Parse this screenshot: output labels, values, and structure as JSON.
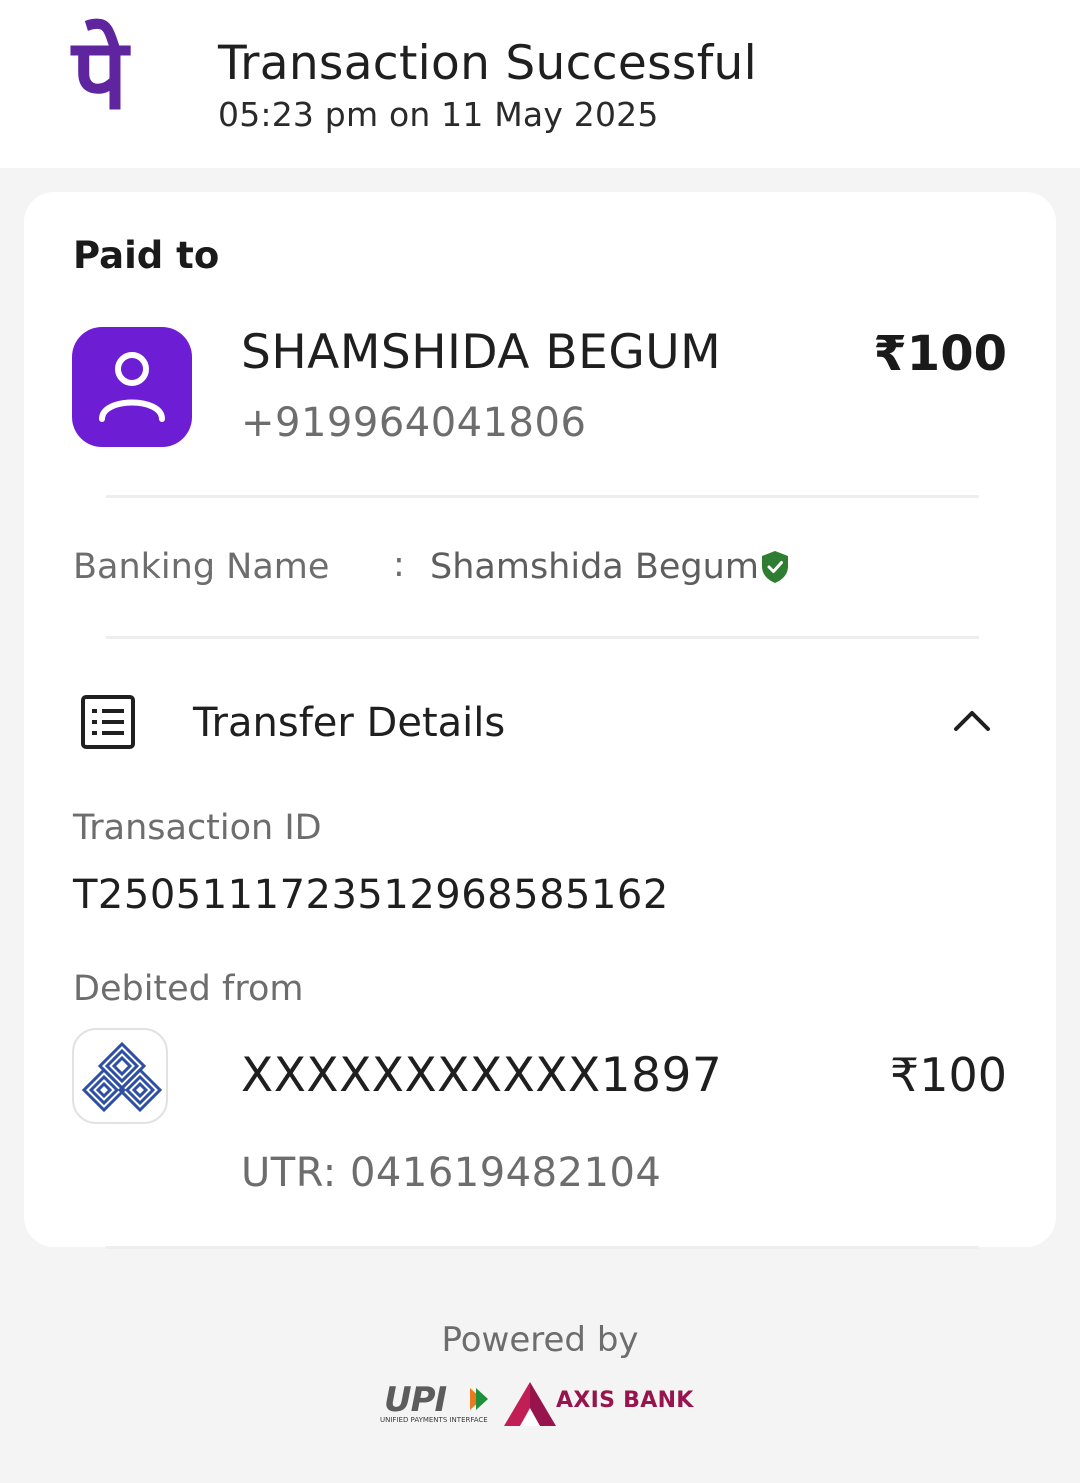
{
  "header": {
    "logo_glyph": "पे",
    "title": "Transaction Successful",
    "timestamp": "05:23 pm on 11 May 2025"
  },
  "paid_to": {
    "section_label": "Paid to",
    "name": "SHAMSHIDA BEGUM",
    "phone": "+919964041806",
    "amount": "₹100",
    "avatar_icon": "person-icon",
    "avatar_color": "#6d1ed4"
  },
  "banking_name": {
    "label": "Banking Name",
    "separator": ":",
    "value": "Shamshida Begum",
    "verified_icon": "verified-shield-icon",
    "verified_color": "#2e7d32"
  },
  "transfer_details": {
    "title": "Transfer Details",
    "icon": "list-icon",
    "toggle_icon": "chevron-up-icon",
    "transaction_id_label": "Transaction ID",
    "transaction_id": "T2505111723512968585162",
    "debited_from_label": "Debited from",
    "account_number": "XXXXXXXXXXX1897",
    "amount": "₹100",
    "utr": "UTR: 041619482104",
    "bank_icon": "bank-logo-icon"
  },
  "footer": {
    "powered_by": "Powered by",
    "upi_logo_text": "UPI",
    "upi_subtext": "UNIFIED PAYMENTS INTERFACE",
    "partner_bank": "AXIS BANK",
    "partner_color": "#97144d"
  },
  "colors": {
    "brand": "#5f259f",
    "background": "#f4f4f4"
  }
}
